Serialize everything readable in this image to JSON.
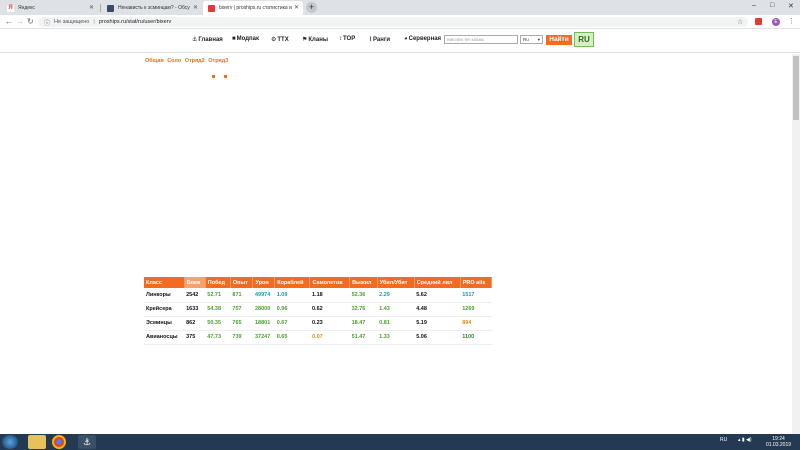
{
  "browser": {
    "tabs": [
      {
        "label": "Яндекс",
        "icon": "yandex-icon"
      },
      {
        "label": "Ненависть к эсминцам? - Обсу",
        "icon": "forum-icon"
      },
      {
        "label": "bixerv | proships.ru статистика  и",
        "icon": "proships-icon",
        "active": true
      }
    ],
    "new_tab": "+",
    "win_min": "–",
    "win_max": "□",
    "win_close": "✕",
    "not_secure": "Не защищено",
    "url": "proships.ru/stat/ru/user/bixerv",
    "profile_initial": "E"
  },
  "site_nav": {
    "items": [
      {
        "label": "Главная",
        "icon": "anchor-icon"
      },
      {
        "label": "Модпак",
        "icon": "box-icon"
      },
      {
        "label": "ТТХ",
        "icon": "gear-icon"
      },
      {
        "label": "Кланы",
        "icon": "clan-icon"
      },
      {
        "label": "TOP",
        "icon": "top-icon"
      },
      {
        "label": "Ранги",
        "icon": "chart-icon"
      },
      {
        "label": "Серверная",
        "icon": "pie-icon"
      }
    ],
    "search_placeholder": "ник или тег клана",
    "realm": "Ru",
    "find_label": "Найти",
    "lang": "RU"
  },
  "modes": [
    "Общая",
    "Соло",
    "Отряд2",
    "Отряд3"
  ],
  "table": {
    "headers": [
      "Класс",
      "Боев",
      "Побед",
      "Опыт",
      "Урон",
      "Кораблей",
      "Самолетов",
      "Выжил",
      "Убил/Убит",
      "Средний лвл",
      "PRO ails"
    ],
    "rows": [
      [
        "Линкоры",
        "2542",
        "52.71",
        "871",
        "49974",
        "1.09",
        "1.18",
        "52.36",
        "2.29",
        "5.62",
        "1517"
      ],
      [
        "Крейсера",
        "1633",
        "54.38",
        "757",
        "28000",
        "0.96",
        "0.62",
        "32.76",
        "1.43",
        "4.48",
        "1269"
      ],
      [
        "Эсминцы",
        "862",
        "50.35",
        "765",
        "18801",
        "0.67",
        "0.23",
        "18.47",
        "0.81",
        "5.19",
        "894"
      ],
      [
        "Авианосцы",
        "375",
        "47.73",
        "739",
        "37247",
        "0.65",
        "0.07",
        "51.47",
        "1.33",
        "5.06",
        "1100"
      ]
    ],
    "colors": [
      [
        "c-black",
        "c-black",
        "c-green",
        "c-green",
        "c-teal",
        "c-teal",
        "c-black",
        "c-green",
        "c-teal",
        "c-black",
        "c-teal"
      ],
      [
        "c-black",
        "c-black",
        "c-green",
        "c-green",
        "c-green",
        "c-green",
        "c-black",
        "c-green",
        "c-green",
        "c-black",
        "c-green"
      ],
      [
        "c-black",
        "c-black",
        "c-green",
        "c-green",
        "c-green",
        "c-green",
        "c-black",
        "c-green",
        "c-green",
        "c-black",
        "c-orange"
      ],
      [
        "c-black",
        "c-black",
        "c-green",
        "c-green",
        "c-green",
        "c-green",
        "c-orange",
        "c-green",
        "c-green",
        "c-black",
        "c-dgreen"
      ]
    ]
  },
  "taskbar": {
    "lang": "RU",
    "time": "19:24",
    "date": "01.03.2019"
  },
  "colors": {
    "accent": "#f26b21",
    "green": "#4a9f2c",
    "teal": "#1c9aa8"
  }
}
